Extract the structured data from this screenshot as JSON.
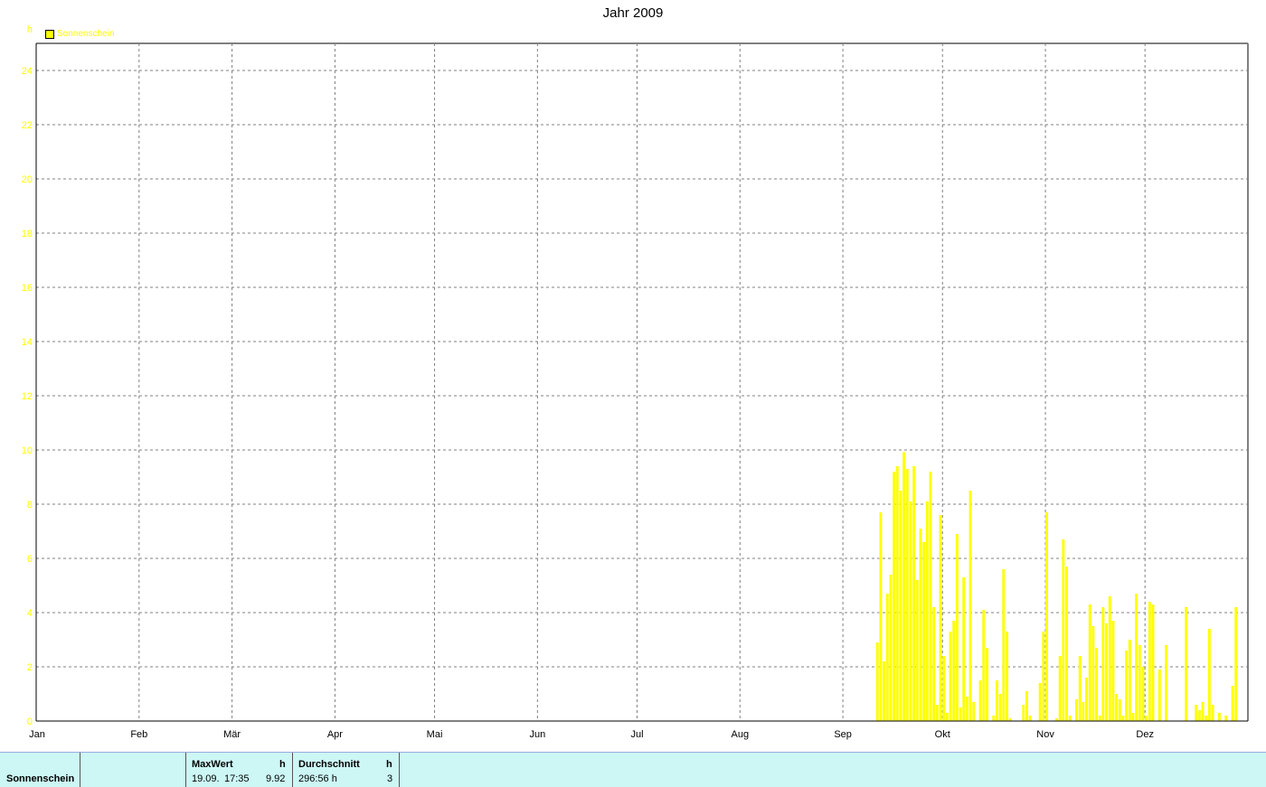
{
  "chart_data": {
    "type": "bar",
    "title": "Jahr 2009",
    "ylabel": "h",
    "ylim": [
      0,
      25
    ],
    "yticks": [
      "0",
      "2",
      "4",
      "6",
      "8",
      "10",
      "12",
      "14",
      "16",
      "18",
      "20",
      "22",
      "24"
    ],
    "month_labels": [
      "Jan",
      "Feb",
      "Mär",
      "Apr",
      "Mai",
      "Jun",
      "Jul",
      "Aug",
      "Sep",
      "Okt",
      "Nov",
      "Dez"
    ],
    "grid": true,
    "legend_position": "top-left",
    "series": [
      {
        "name": "Sonnenschein",
        "color": "#ffff00",
        "points": [
          {
            "day": "2009-09-11",
            "value": 2.9
          },
          {
            "day": "2009-09-12",
            "value": 7.7
          },
          {
            "day": "2009-09-13",
            "value": 2.2
          },
          {
            "day": "2009-09-14",
            "value": 4.7
          },
          {
            "day": "2009-09-15",
            "value": 5.4
          },
          {
            "day": "2009-09-16",
            "value": 9.2
          },
          {
            "day": "2009-09-17",
            "value": 9.4
          },
          {
            "day": "2009-09-18",
            "value": 8.5
          },
          {
            "day": "2009-09-19",
            "value": 9.92
          },
          {
            "day": "2009-09-20",
            "value": 9.3
          },
          {
            "day": "2009-09-21",
            "value": 8.1
          },
          {
            "day": "2009-09-22",
            "value": 9.4
          },
          {
            "day": "2009-09-23",
            "value": 5.2
          },
          {
            "day": "2009-09-24",
            "value": 7.1
          },
          {
            "day": "2009-09-25",
            "value": 6.6
          },
          {
            "day": "2009-09-26",
            "value": 8.1
          },
          {
            "day": "2009-09-27",
            "value": 9.2
          },
          {
            "day": "2009-09-28",
            "value": 4.2
          },
          {
            "day": "2009-09-29",
            "value": 0.6
          },
          {
            "day": "2009-09-30",
            "value": 7.6
          },
          {
            "day": "2009-10-01",
            "value": 2.4
          },
          {
            "day": "2009-10-02",
            "value": 0.3
          },
          {
            "day": "2009-10-03",
            "value": 3.3
          },
          {
            "day": "2009-10-04",
            "value": 3.7
          },
          {
            "day": "2009-10-05",
            "value": 6.9
          },
          {
            "day": "2009-10-06",
            "value": 0.5
          },
          {
            "day": "2009-10-07",
            "value": 5.3
          },
          {
            "day": "2009-10-08",
            "value": 0.9
          },
          {
            "day": "2009-10-09",
            "value": 8.5
          },
          {
            "day": "2009-10-10",
            "value": 0.7
          },
          {
            "day": "2009-10-12",
            "value": 1.5
          },
          {
            "day": "2009-10-13",
            "value": 4.1
          },
          {
            "day": "2009-10-14",
            "value": 2.7
          },
          {
            "day": "2009-10-16",
            "value": 0.2
          },
          {
            "day": "2009-10-17",
            "value": 1.5
          },
          {
            "day": "2009-10-18",
            "value": 1.0
          },
          {
            "day": "2009-10-19",
            "value": 5.6
          },
          {
            "day": "2009-10-20",
            "value": 3.3
          },
          {
            "day": "2009-10-21",
            "value": 0.1
          },
          {
            "day": "2009-10-25",
            "value": 0.6
          },
          {
            "day": "2009-10-26",
            "value": 1.1
          },
          {
            "day": "2009-10-27",
            "value": 0.2
          },
          {
            "day": "2009-10-30",
            "value": 1.4
          },
          {
            "day": "2009-10-31",
            "value": 3.3
          },
          {
            "day": "2009-11-01",
            "value": 7.7
          },
          {
            "day": "2009-11-04",
            "value": 0.1
          },
          {
            "day": "2009-11-05",
            "value": 2.4
          },
          {
            "day": "2009-11-06",
            "value": 6.7
          },
          {
            "day": "2009-11-07",
            "value": 5.7
          },
          {
            "day": "2009-11-08",
            "value": 0.2
          },
          {
            "day": "2009-11-10",
            "value": 0.8
          },
          {
            "day": "2009-11-11",
            "value": 2.4
          },
          {
            "day": "2009-11-12",
            "value": 0.7
          },
          {
            "day": "2009-11-13",
            "value": 1.6
          },
          {
            "day": "2009-11-14",
            "value": 4.3
          },
          {
            "day": "2009-11-15",
            "value": 3.5
          },
          {
            "day": "2009-11-16",
            "value": 2.7
          },
          {
            "day": "2009-11-17",
            "value": 0.2
          },
          {
            "day": "2009-11-18",
            "value": 4.2
          },
          {
            "day": "2009-11-19",
            "value": 3.6
          },
          {
            "day": "2009-11-20",
            "value": 4.6
          },
          {
            "day": "2009-11-21",
            "value": 3.7
          },
          {
            "day": "2009-11-22",
            "value": 1.0
          },
          {
            "day": "2009-11-23",
            "value": 0.8
          },
          {
            "day": "2009-11-24",
            "value": 0.2
          },
          {
            "day": "2009-11-25",
            "value": 2.6
          },
          {
            "day": "2009-11-26",
            "value": 3.0
          },
          {
            "day": "2009-11-27",
            "value": 0.3
          },
          {
            "day": "2009-11-28",
            "value": 4.7
          },
          {
            "day": "2009-11-29",
            "value": 2.8
          },
          {
            "day": "2009-11-30",
            "value": 2.0
          },
          {
            "day": "2009-12-01",
            "value": 0.2
          },
          {
            "day": "2009-12-02",
            "value": 4.4
          },
          {
            "day": "2009-12-03",
            "value": 4.3
          },
          {
            "day": "2009-12-05",
            "value": 1.9
          },
          {
            "day": "2009-12-07",
            "value": 2.8
          },
          {
            "day": "2009-12-13",
            "value": 4.2
          },
          {
            "day": "2009-12-16",
            "value": 0.6
          },
          {
            "day": "2009-12-17",
            "value": 0.4
          },
          {
            "day": "2009-12-18",
            "value": 0.7
          },
          {
            "day": "2009-12-19",
            "value": 0.2
          },
          {
            "day": "2009-12-20",
            "value": 3.4
          },
          {
            "day": "2009-12-21",
            "value": 0.6
          },
          {
            "day": "2009-12-23",
            "value": 0.3
          },
          {
            "day": "2009-12-25",
            "value": 0.2
          },
          {
            "day": "2009-12-27",
            "value": 1.3
          },
          {
            "day": "2009-12-28",
            "value": 4.2
          }
        ]
      }
    ]
  },
  "stats": {
    "row_label": "Sonnenschein",
    "max_header": "MaxWert",
    "max_unit": "h",
    "max_date": "19.09.",
    "max_time": "17:35",
    "max_value": "9.92",
    "avg_header": "Durchschnitt",
    "avg_unit": "h",
    "avg_total": "296:56 h",
    "avg_value": "3"
  }
}
